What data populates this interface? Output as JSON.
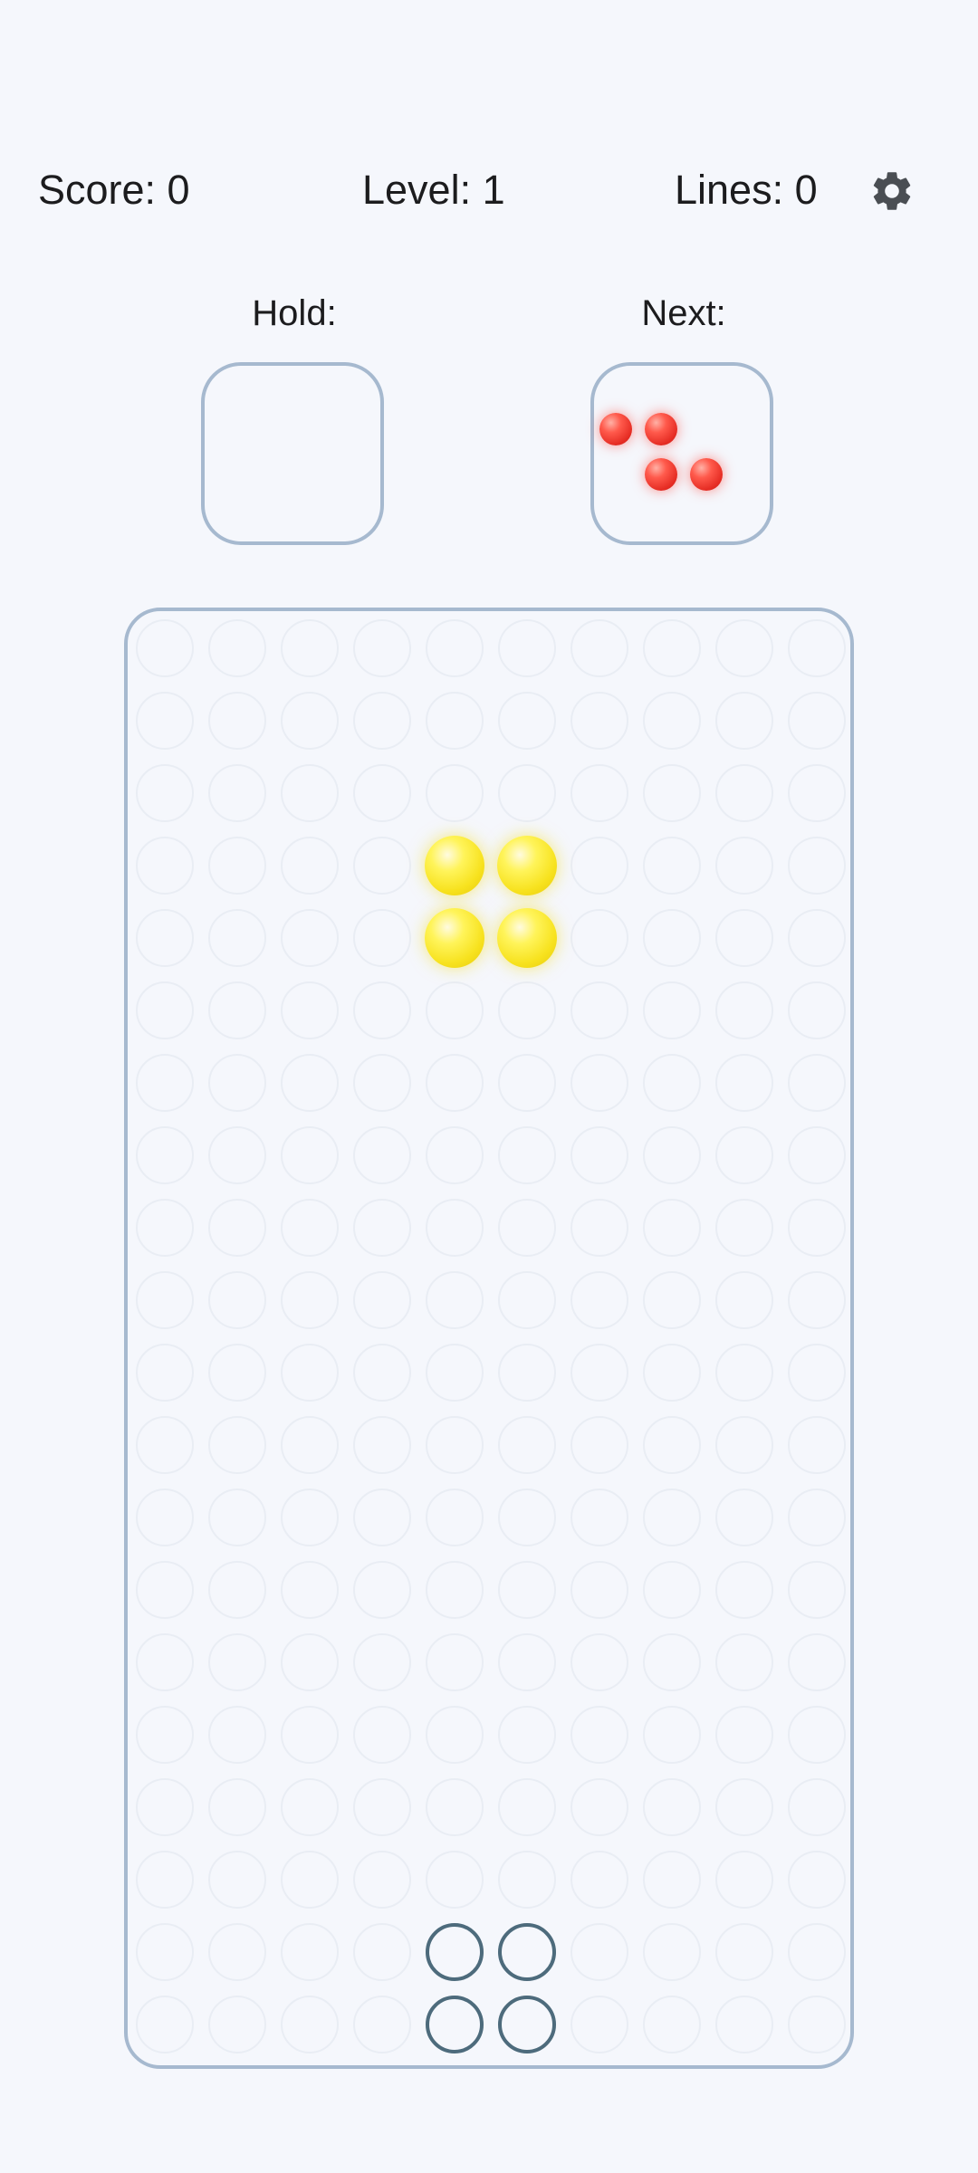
{
  "hud": {
    "score_text": "Score: 0",
    "level_text": "Level: 1",
    "lines_text": "Lines: 0",
    "settings_icon": "gear-icon"
  },
  "hold": {
    "label": "Hold:",
    "piece": null
  },
  "next": {
    "label": "Next:",
    "piece": "Z",
    "color": "#ff3b30",
    "cells": [
      [
        0,
        0
      ],
      [
        1,
        0
      ],
      [
        1,
        1
      ],
      [
        2,
        1
      ]
    ]
  },
  "board": {
    "columns": 10,
    "rows": 20,
    "grid_color": "#e9edf4",
    "border_color": "#a6b9cf",
    "active_piece": {
      "type": "O",
      "color": "#f7e21e",
      "cells": [
        [
          4,
          3
        ],
        [
          5,
          3
        ],
        [
          4,
          4
        ],
        [
          5,
          4
        ]
      ]
    },
    "ghost_piece": {
      "color": "#4d6b7c",
      "cells": [
        [
          4,
          18
        ],
        [
          5,
          18
        ],
        [
          4,
          19
        ],
        [
          5,
          19
        ]
      ]
    }
  }
}
